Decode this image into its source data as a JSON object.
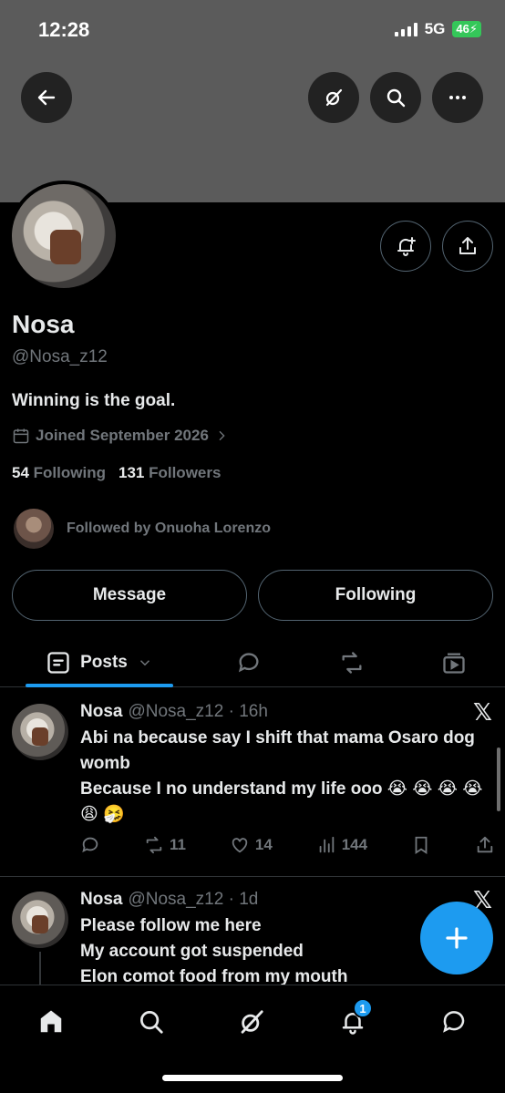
{
  "status_bar": {
    "time": "12:28",
    "network": "5G",
    "battery": "46"
  },
  "header": {
    "back_icon": "arrow-left-icon",
    "grok_icon": "grok-icon",
    "search_icon": "search-icon",
    "more_icon": "more-dots-icon"
  },
  "profile": {
    "name": "Nosa",
    "handle": "@Nosa_z12",
    "bio": "Winning is the goal.",
    "joined": "Joined September 2026",
    "following_count": "54",
    "following_label": "Following",
    "followers_count": "131",
    "followers_label": "Followers",
    "followed_by": "Followed by Onuoha Lorenzo"
  },
  "buttons": {
    "message": "Message",
    "following": "Following"
  },
  "tabs": {
    "posts": "Posts"
  },
  "posts": [
    {
      "name": "Nosa",
      "meta": "@Nosa_z12 · 16h",
      "text": "Abi na because say I shift that mama Osaro dog womb\nBecause I no understand my life ooo 😭 😭 😭 😭 😩 🤧",
      "reposts": "11",
      "likes": "14",
      "views": "144",
      "x_logo": "𝕏"
    },
    {
      "name": "Nosa",
      "meta": "@Nosa_z12 · 1d",
      "text": "Please follow me here\nMy account got suspended\nElon comot food from my mouth",
      "x_logo": "𝕏"
    }
  ],
  "bottom_nav": {
    "notification_badge": "1"
  },
  "colors": {
    "accent": "#1d9bf0",
    "banner": "#5b5b5b",
    "muted": "#71767b",
    "border": "#2f3336"
  }
}
